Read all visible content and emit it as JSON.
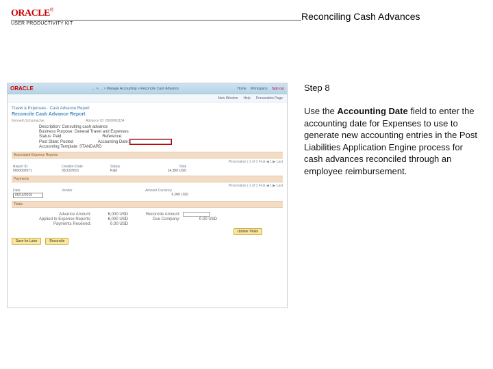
{
  "logo": {
    "brand": "ORACLE",
    "tm": "®",
    "sub": "USER PRODUCTIVITY KIT"
  },
  "doc_title": "Reconciling Cash Advances",
  "step": "Step 8",
  "instruction_pre": "Use the ",
  "instruction_bold": "Accounting Date",
  "instruction_post": " field to enter the accounting date for Expenses to use to generate new accounting entries in the Post Liabilities Application Engine process for cash advances reconciled through an employee reimbursement.",
  "shot": {
    "brand": "ORACLE",
    "crumbs": "… > … > Manage Accounting > Reconcile Cash Advance",
    "nav": {
      "home": "Home",
      "workspace": "Workspace",
      "signout": "Sign out"
    },
    "subnav": {
      "newwin": "New Window",
      "help": "Help",
      "personalize": "Personalize Page"
    },
    "section": "Travel & Expenses · Cash Advance Report",
    "page_title": "Reconcile Cash Advance Report",
    "employee": "Kenneth Schumacher",
    "advance_id_lbl": "Advance ID:",
    "advance_id": "0000000154",
    "rows": {
      "description": "Description: Consulting cash advance",
      "business_purpose": "Business Purpose: General Travel and Expenses",
      "status": "Status: Paid",
      "reference": "Reference:",
      "post_state": "Post State: Posted",
      "accounting_date": "Accounting Date:",
      "accounting_template": "Accounting Template: STANDARD"
    },
    "date_value": "",
    "section2": "Associated Expense Reports",
    "pager1": "Personalize | 1 of 1   First  ◀ 1 ▶  Last",
    "table": {
      "hd": [
        "Report ID",
        "Creation Date",
        "Status",
        "Total"
      ],
      "row": [
        "0000002671",
        "05/13/2015",
        "Paid",
        "14,300 USD"
      ]
    },
    "section3": "Payments",
    "pager2": "Personalize | 1 of 1   First  ◀ 1 ▶  Last",
    "table2": {
      "hd": [
        "Date",
        "Vendor",
        "Amount Currency"
      ],
      "row": [
        "05/14/2015",
        "",
        "6,000 USD"
      ]
    },
    "totals_title": "Totals",
    "totals": {
      "advance_amount_lbl": "Advance Amount:",
      "advance_amount": "6,000  USD",
      "applied_lbl": "Applied to Expense Reports:",
      "applied": "6,000  USD",
      "payments_lbl": "Payments Received:",
      "payments": "0.00  USD",
      "reconcile_lbl": "Reconcile Amount:",
      "reconcile": "",
      "due_company_lbl": "Due Company:",
      "due_company": "0.00  USD"
    },
    "update_totals": "Update Totals",
    "save_later": "Save for Later",
    "reconcile": "Reconcile"
  }
}
